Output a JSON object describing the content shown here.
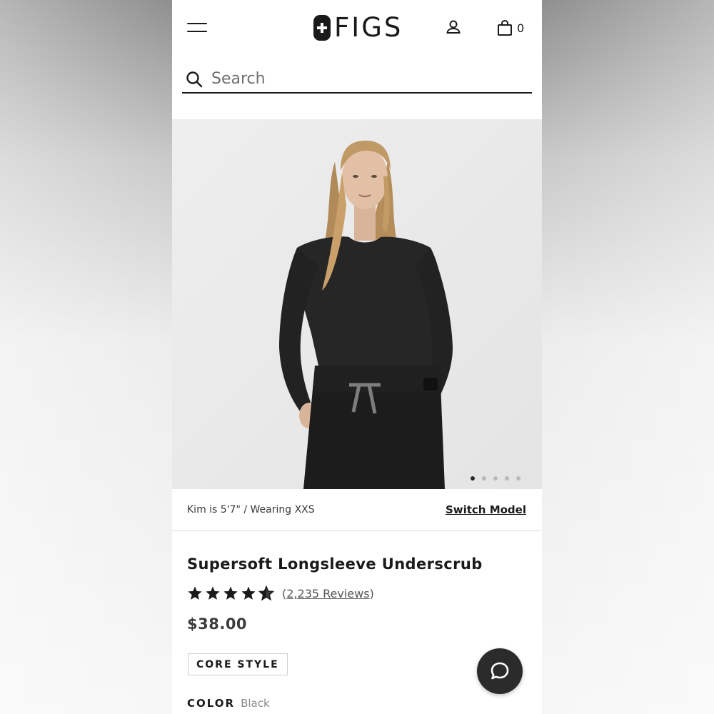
{
  "header": {
    "brand_name": "FIGS",
    "cart_count": "0",
    "icons": [
      "menu-icon",
      "account-icon",
      "shopping-bag-icon"
    ]
  },
  "search": {
    "placeholder": "Search",
    "value": ""
  },
  "gallery": {
    "image_count": 5,
    "active_index": 0
  },
  "model": {
    "info": "Kim is 5'7\" / Wearing XXS",
    "switch_label": "Switch Model"
  },
  "product": {
    "title": "Supersoft Longsleeve Underscrub",
    "rating": 4.5,
    "reviews_open": "(",
    "reviews_link": "2,235 Reviews",
    "reviews_close": ")",
    "price": "$38.00",
    "badge": "CORE STYLE",
    "color_label": "COLOR",
    "color_value": "Black"
  },
  "colors": {
    "text": "#1a1a1a",
    "image_background": "#ebebeb",
    "chat_button": "#2b2b2b"
  }
}
